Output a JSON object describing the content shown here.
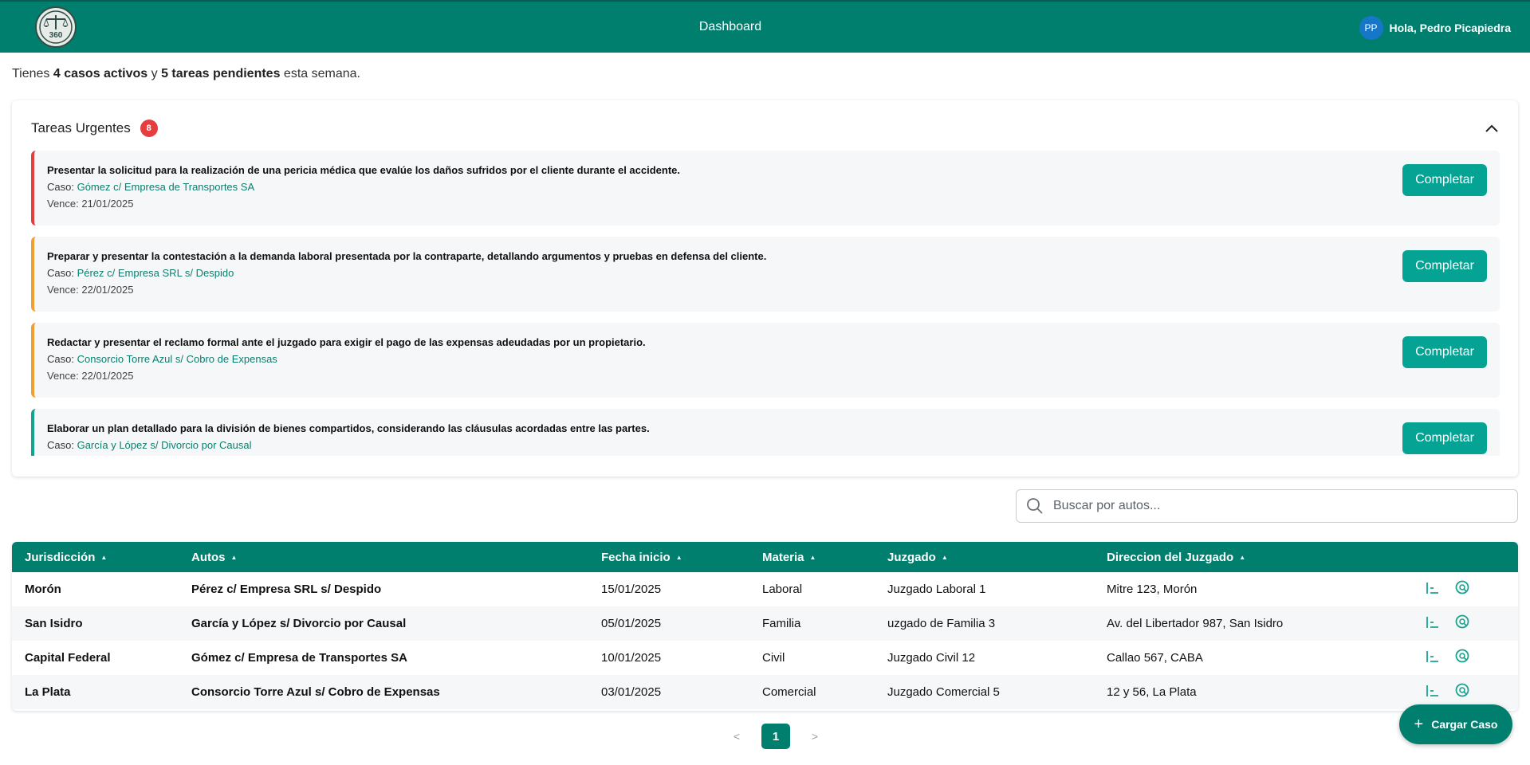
{
  "header": {
    "title": "Dashboard",
    "user": {
      "initials": "PP",
      "greeting": "Hola, Pedro Picapiedra"
    },
    "brand_color": "#007f6f"
  },
  "summary": {
    "prefix": "Tienes ",
    "cases": "4 casos activos",
    "middle": " y ",
    "tasks": "5 tareas pendientes",
    "suffix": " esta semana."
  },
  "urgent_tasks": {
    "title": "Tareas Urgentes",
    "count": "8",
    "case_label": "Caso: ",
    "due_label": "Vence: ",
    "complete_label": "Completar",
    "items": [
      {
        "description": "Presentar la solicitud para la realización de una pericia médica que evalúe los daños sufridos por el cliente durante el accidente.",
        "case": "Gómez c/ Empresa de Transportes SA",
        "due": "21/01/2025",
        "priority_color": "#e53e3e"
      },
      {
        "description": "Preparar y presentar la contestación a la demanda laboral presentada por la contraparte, detallando argumentos y pruebas en defensa del cliente.",
        "case": "Pérez c/ Empresa SRL s/ Despido",
        "due": "22/01/2025",
        "priority_color": "#f0a030"
      },
      {
        "description": "Redactar y presentar el reclamo formal ante el juzgado para exigir el pago de las expensas adeudadas por un propietario.",
        "case": "Consorcio Torre Azul s/ Cobro de Expensas",
        "due": "22/01/2025",
        "priority_color": "#f0a030"
      },
      {
        "description": "Elaborar un plan detallado para la división de bienes compartidos, considerando las cláusulas acordadas entre las partes.",
        "case": "García y López s/ Divorcio por Causal",
        "due": "",
        "priority_color": "#12a391"
      }
    ]
  },
  "search": {
    "placeholder": "Buscar por autos..."
  },
  "cases_table": {
    "columns": [
      "Jurisdicción",
      "Autos",
      "Fecha inicio",
      "Materia",
      "Juzgado",
      "Direccion del Juzgado"
    ],
    "rows": [
      {
        "jurisdiccion": "Morón",
        "autos": "Pérez c/ Empresa SRL s/ Despido",
        "fecha": "15/01/2025",
        "materia": "Laboral",
        "juzgado": "Juzgado Laboral 1",
        "direccion": "Mitre 123, Morón"
      },
      {
        "jurisdiccion": "San Isidro",
        "autos": "García y López s/ Divorcio por Causal",
        "fecha": "05/01/2025",
        "materia": "Familia",
        "juzgado": "uzgado de Familia 3",
        "direccion": "Av. del Libertador 987, San Isidro"
      },
      {
        "jurisdiccion": "Capital Federal",
        "autos": "Gómez c/ Empresa de Transportes SA",
        "fecha": "10/01/2025",
        "materia": "Civil",
        "juzgado": "Juzgado Civil 12",
        "direccion": "Callao 567, CABA"
      },
      {
        "jurisdiccion": "La Plata",
        "autos": "Consorcio Torre Azul s/ Cobro de Expensas",
        "fecha": "03/01/2025",
        "materia": "Comercial",
        "juzgado": "Juzgado Comercial 5",
        "direccion": "12 y 56, La Plata"
      }
    ],
    "row_actions": [
      "tasks-list-icon",
      "search-case-icon"
    ]
  },
  "pagination": {
    "prev": "<",
    "current": "1",
    "next": ">"
  },
  "fab": {
    "label": "Cargar Caso",
    "icon": "plus-icon"
  }
}
